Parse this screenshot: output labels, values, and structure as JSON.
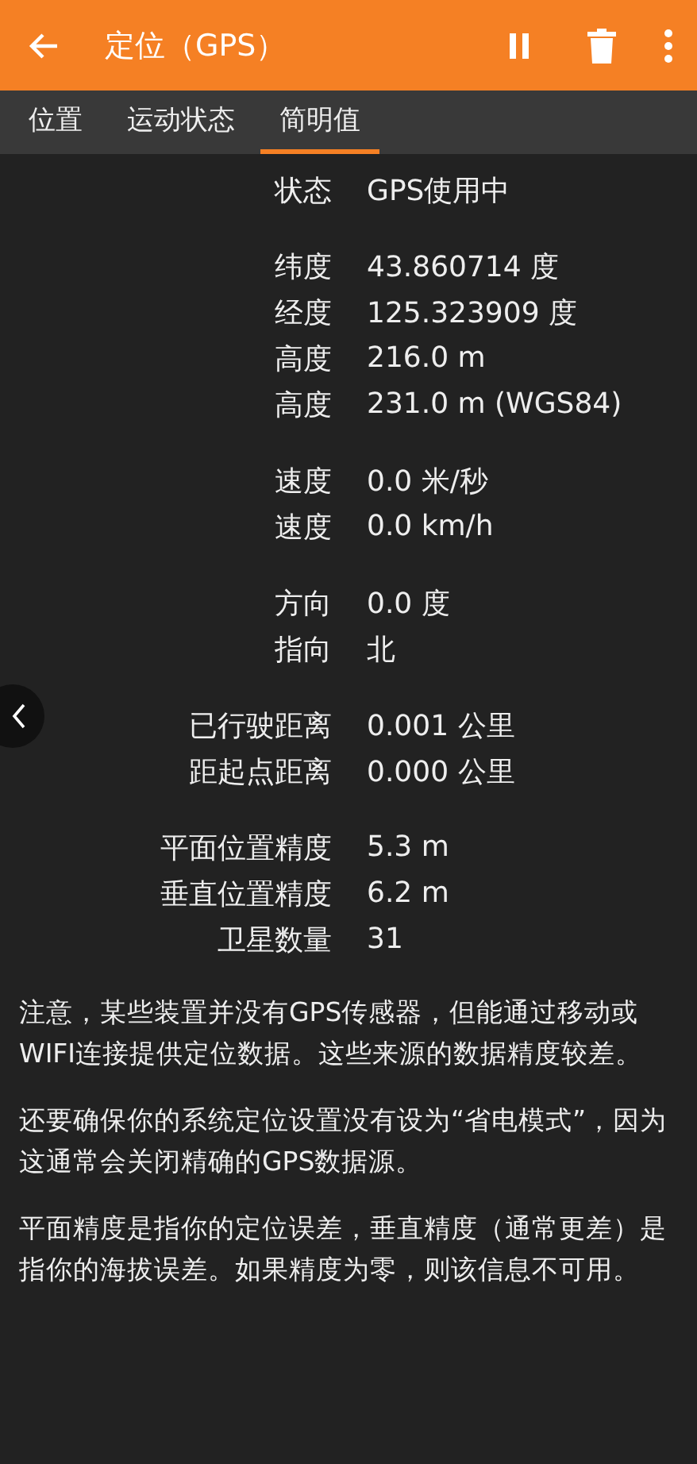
{
  "app_bar": {
    "title": "定位（GPS）"
  },
  "tabs": [
    {
      "label": "位置",
      "selected": false
    },
    {
      "label": "运动状态",
      "selected": false
    },
    {
      "label": "简明值",
      "selected": true
    }
  ],
  "groups": [
    [
      {
        "label": "状态",
        "value": "GPS使用中"
      }
    ],
    [
      {
        "label": "纬度",
        "value": "43.860714 度"
      },
      {
        "label": "经度",
        "value": "125.323909 度"
      },
      {
        "label": "高度",
        "value": "216.0 m"
      },
      {
        "label": "高度",
        "value": "231.0 m (WGS84)"
      }
    ],
    [
      {
        "label": "速度",
        "value": "0.0 米/秒"
      },
      {
        "label": "速度",
        "value": "0.0 km/h"
      }
    ],
    [
      {
        "label": "方向",
        "value": "0.0 度"
      },
      {
        "label": "指向",
        "value": "北"
      }
    ],
    [
      {
        "label": "已行驶距离",
        "value": "0.001 公里"
      },
      {
        "label": "距起点距离",
        "value": "0.000 公里"
      }
    ],
    [
      {
        "label": "平面位置精度",
        "value": "5.3 m"
      },
      {
        "label": "垂直位置精度",
        "value": "6.2 m"
      },
      {
        "label": "卫星数量",
        "value": "31"
      }
    ]
  ],
  "notes": [
    "注意，某些装置并没有GPS传感器，但能通过移动或WIFI连接提供定位数据。这些来源的数据精度较差。",
    "还要确保你的系统定位设置没有设为“省电模式”，因为这通常会关闭精确的GPS数据源。",
    "平面精度是指你的定位误差，垂直精度（通常更差）是指你的海拔误差。如果精度为零，则该信息不可用。"
  ]
}
